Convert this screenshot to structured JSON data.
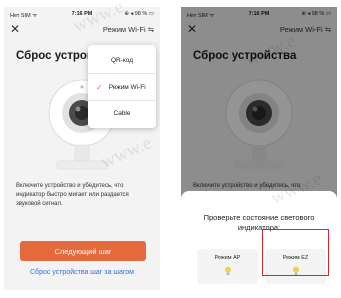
{
  "screens": [
    {
      "status": {
        "carrier": "Нет SIM ᯤ",
        "time": "7:16 PM",
        "battery": "⊕ ◂ 98 % ▭"
      },
      "nav": {
        "close": "✕",
        "mode": "Режим Wi-Fi ⇋"
      },
      "title": "Сброс устройства",
      "description": "Включите устройство и убедитесь, что индикатор быстро мигает или раздается звуковой сигнал.",
      "primary_button": "Следующий шаг",
      "link": "Сброс устройства шаг за шагом",
      "dropdown": {
        "options": [
          "QR-код",
          "Режим Wi-Fi",
          "Cable"
        ],
        "selected": "Режим Wi-Fi",
        "check_icon": "✓"
      }
    },
    {
      "status": {
        "carrier": "Нет SIM ᯤ",
        "time": "7:16 PM",
        "battery": "⊕ ◂ 98 % ▭"
      },
      "nav": {
        "close": "✕",
        "mode": "Режим Wi-Fi ⇋"
      },
      "title": "Сброс устройства",
      "description_partial": "Включите устройство и убедитесь, что",
      "sheet": {
        "question": "Проверьте состояние светового индикатора:",
        "modes": [
          {
            "label": "Режим AP",
            "icon": "bulb-icon"
          },
          {
            "label": "Режим EZ",
            "icon": "bulb-icon",
            "highlighted": true
          }
        ]
      }
    }
  ],
  "colors": {
    "accent": "#e46a3e",
    "link": "#3a6ed8",
    "highlight": "#d9252a"
  },
  "watermark": "www.e"
}
